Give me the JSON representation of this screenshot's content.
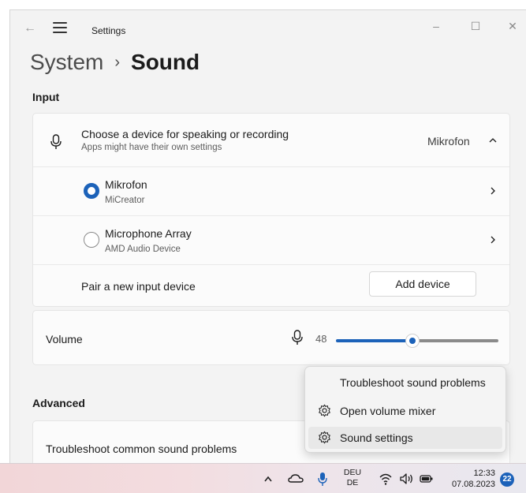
{
  "window": {
    "app_title": "Settings",
    "controls": {
      "minimize": "–",
      "maximize": "☐",
      "close": "✕"
    }
  },
  "breadcrumb": {
    "parent": "System",
    "separator": "›",
    "current": "Sound"
  },
  "input": {
    "section_label": "Input",
    "chooser": {
      "title": "Choose a device for speaking or recording",
      "subtitle": "Apps might have their own settings",
      "selected_value": "Mikrofon",
      "expanded": true
    },
    "devices": [
      {
        "name": "Mikrofon",
        "description": "MiCreator",
        "selected": true
      },
      {
        "name": "Microphone Array",
        "description": "AMD Audio Device",
        "selected": false
      }
    ],
    "pair": {
      "label": "Pair a new input device",
      "button": "Add device"
    }
  },
  "volume": {
    "label": "Volume",
    "value": 48,
    "max": 100,
    "accent": "#1c62b9"
  },
  "advanced": {
    "section_label": "Advanced",
    "troubleshoot_label": "Troubleshoot common sound problems"
  },
  "context_menu": {
    "items": [
      {
        "label": "Troubleshoot sound problems",
        "icon": ""
      },
      {
        "label": "Open volume mixer",
        "icon": "gear-icon"
      },
      {
        "label": "Sound settings",
        "icon": "gear-icon"
      }
    ]
  },
  "taskbar": {
    "language": {
      "line1": "DEU",
      "line2": "DE"
    },
    "time": "12:33",
    "date": "07.08.2023",
    "notification_count": "22"
  }
}
